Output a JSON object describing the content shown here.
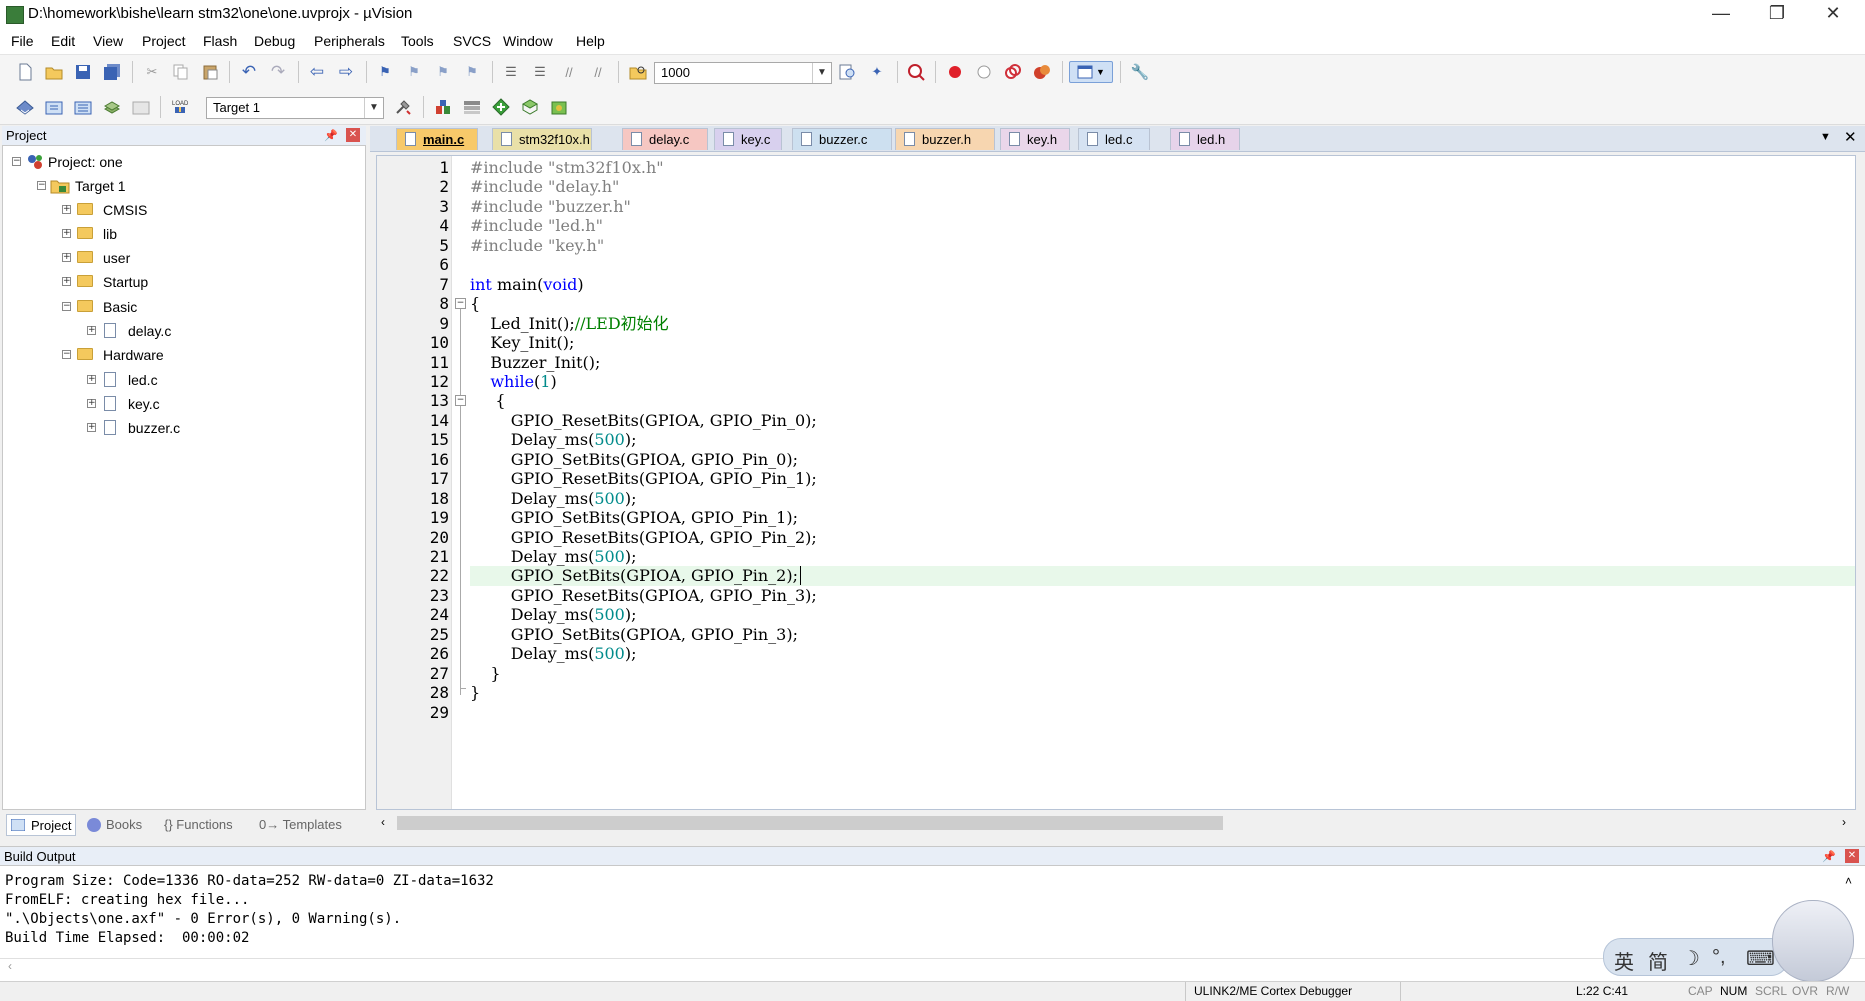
{
  "window": {
    "title": "D:\\homework\\bishe\\learn stm32\\one\\one.uvprojx - µVision",
    "minimize": "—",
    "restore": "❐",
    "close": "✕"
  },
  "menu": [
    "File",
    "Edit",
    "View",
    "Project",
    "Flash",
    "Debug",
    "Peripherals",
    "Tools",
    "SVCS",
    "Window",
    "Help"
  ],
  "toolbar1": {
    "find_value": "1000"
  },
  "toolbar2": {
    "target_value": "Target 1"
  },
  "project_pane": {
    "title": "Project",
    "tree": [
      {
        "label": "Project: one",
        "level": 0,
        "type": "project",
        "expanded": true
      },
      {
        "label": "Target 1",
        "level": 1,
        "type": "target",
        "expanded": true
      },
      {
        "label": "CMSIS",
        "level": 2,
        "type": "folder",
        "expanded": false
      },
      {
        "label": "lib",
        "level": 2,
        "type": "folder",
        "expanded": false
      },
      {
        "label": "user",
        "level": 2,
        "type": "folder",
        "expanded": false
      },
      {
        "label": "Startup",
        "level": 2,
        "type": "folder",
        "expanded": false
      },
      {
        "label": "Basic",
        "level": 2,
        "type": "folder",
        "expanded": true
      },
      {
        "label": "delay.c",
        "level": 3,
        "type": "file",
        "expanded": false
      },
      {
        "label": "Hardware",
        "level": 2,
        "type": "folder",
        "expanded": true
      },
      {
        "label": "led.c",
        "level": 3,
        "type": "file",
        "expanded": false
      },
      {
        "label": "key.c",
        "level": 3,
        "type": "file",
        "expanded": false
      },
      {
        "label": "buzzer.c",
        "level": 3,
        "type": "file",
        "expanded": false
      }
    ],
    "tabs": [
      "Project",
      "Books",
      "{} Functions",
      "0→ Templates"
    ]
  },
  "editor": {
    "tabs": [
      {
        "label": "main.c",
        "active": true,
        "color": "#f7c96a"
      },
      {
        "label": "stm32f10x.h",
        "active": false,
        "color": "#e9e0a8"
      },
      {
        "label": "delay.c",
        "active": false,
        "color": "#f6c7c2"
      },
      {
        "label": "key.c",
        "active": false,
        "color": "#d8d0ee"
      },
      {
        "label": "buzzer.c",
        "active": false,
        "color": "#cde0f0"
      },
      {
        "label": "buzzer.h",
        "active": false,
        "color": "#f7d6b0"
      },
      {
        "label": "key.h",
        "active": false,
        "color": "#ead6ea"
      },
      {
        "label": "led.c",
        "active": false,
        "color": "#d5e2f2"
      },
      {
        "label": "led.h",
        "active": false,
        "color": "#e6d3ea"
      }
    ],
    "current_line": 22,
    "lines": [
      [
        [
          "pp",
          "#include "
        ],
        [
          "str",
          "\"stm32f10x.h\""
        ]
      ],
      [
        [
          "pp",
          "#include "
        ],
        [
          "str",
          "\"delay.h\""
        ]
      ],
      [
        [
          "pp",
          "#include "
        ],
        [
          "str",
          "\"buzzer.h\""
        ]
      ],
      [
        [
          "pp",
          "#include "
        ],
        [
          "str",
          "\"led.h\""
        ]
      ],
      [
        [
          "pp",
          "#include "
        ],
        [
          "str",
          "\"key.h\""
        ]
      ],
      [],
      [
        [
          "kw",
          "int"
        ],
        [
          "t",
          " main("
        ],
        [
          "kw",
          "void"
        ],
        [
          "t",
          ")"
        ]
      ],
      [
        [
          "t",
          "{"
        ]
      ],
      [
        [
          "t",
          "    Led_Init();"
        ],
        [
          "cm",
          "//LED初始化"
        ]
      ],
      [
        [
          "t",
          "    Key_Init();"
        ]
      ],
      [
        [
          "t",
          "    Buzzer_Init();"
        ]
      ],
      [
        [
          "t",
          "    "
        ],
        [
          "kw",
          "while"
        ],
        [
          "t",
          "("
        ],
        [
          "num",
          "1"
        ],
        [
          "t",
          ")"
        ]
      ],
      [
        [
          "t",
          "     {"
        ]
      ],
      [
        [
          "t",
          "        GPIO_ResetBits(GPIOA, GPIO_Pin_0);"
        ]
      ],
      [
        [
          "t",
          "        Delay_ms("
        ],
        [
          "num",
          "500"
        ],
        [
          "t",
          ");"
        ]
      ],
      [
        [
          "t",
          "        GPIO_SetBits(GPIOA, GPIO_Pin_0);"
        ]
      ],
      [
        [
          "t",
          "        GPIO_ResetBits(GPIOA, GPIO_Pin_1);"
        ]
      ],
      [
        [
          "t",
          "        Delay_ms("
        ],
        [
          "num",
          "500"
        ],
        [
          "t",
          ");"
        ]
      ],
      [
        [
          "t",
          "        GPIO_SetBits(GPIOA, GPIO_Pin_1);"
        ]
      ],
      [
        [
          "t",
          "        GPIO_ResetBits(GPIOA, GPIO_Pin_2);"
        ]
      ],
      [
        [
          "t",
          "        Delay_ms("
        ],
        [
          "num",
          "500"
        ],
        [
          "t",
          ");"
        ]
      ],
      [
        [
          "t",
          "        GPIO_SetBits(GPIOA, GPIO_Pin_2);"
        ]
      ],
      [
        [
          "t",
          "        GPIO_ResetBits(GPIOA, GPIO_Pin_3);"
        ]
      ],
      [
        [
          "t",
          "        Delay_ms("
        ],
        [
          "num",
          "500"
        ],
        [
          "t",
          ");"
        ]
      ],
      [
        [
          "t",
          "        GPIO_SetBits(GPIOA, GPIO_Pin_3);"
        ]
      ],
      [
        [
          "t",
          "        Delay_ms("
        ],
        [
          "num",
          "500"
        ],
        [
          "t",
          ");"
        ]
      ],
      [
        [
          "t",
          "    }"
        ]
      ],
      [
        [
          "t",
          "}"
        ]
      ],
      []
    ]
  },
  "build_output": {
    "title": "Build Output",
    "lines": [
      "Program Size: Code=1336 RO-data=252 RW-data=0 ZI-data=1632",
      "FromELF: creating hex file...",
      "\".\\Objects\\one.axf\" - 0 Error(s), 0 Warning(s).",
      "Build Time Elapsed:  00:00:02"
    ]
  },
  "ime": {
    "keys": [
      "英",
      "简",
      "☽",
      "°,",
      "⌨"
    ]
  },
  "status": {
    "debugger": "ULINK2/ME Cortex Debugger",
    "position": "L:22 C:41",
    "cap": "CAP",
    "num": "NUM",
    "scrl": "SCRL",
    "ovr": "OVR",
    "rw": "R/W"
  }
}
